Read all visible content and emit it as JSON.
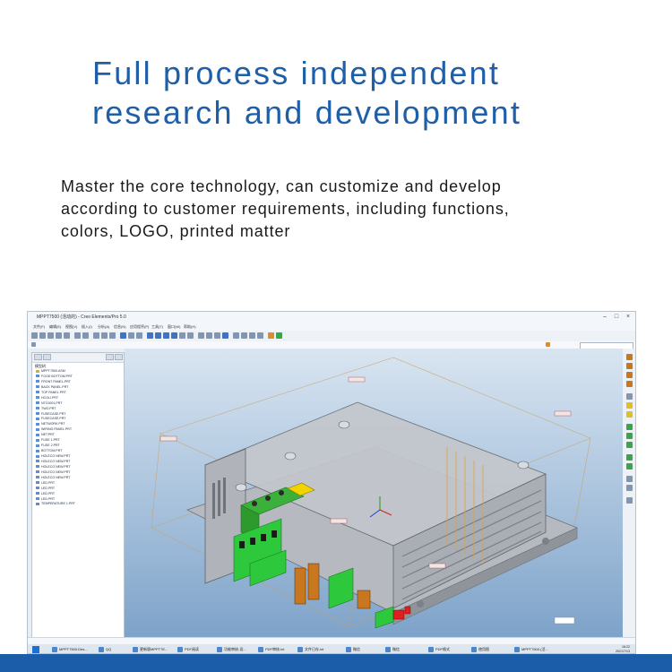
{
  "headline": {
    "line1": "Full process independent",
    "line2": "research and development"
  },
  "subtext": {
    "line1": "Master the core technology, can customize and develop",
    "line2": "according to customer requirements, including functions,",
    "line3": "colors, LOGO, printed matter"
  },
  "screenshot": {
    "window_title": "MPPT7500 (活动的) - Creo Elements/Pro 5.0",
    "menu": [
      "文件(F)",
      "编辑(E)",
      "视图(V)",
      "插入(I)",
      "分析(A)",
      "信息(N)",
      "应用程序(P)",
      "工具(T)",
      "窗口(W)",
      "帮助(H)"
    ],
    "tree_header": "模型树",
    "tree_items": [
      "MPPT7500.ASM",
      "FOOD BOTTOM.PRT",
      "FRONT PANEL.PRT",
      "BACK PANEL.PRT",
      "TOP PANEL.PRT",
      "HCOLI.PRT",
      "NTC0001.PRT",
      "TWO.PRT",
      "FUSECASE.PRT",
      "FUSECASE.PRT",
      "NETWORK.PRT",
      "WIRING PANEL.PRT",
      "NET.PRT",
      "FUSE 1.PRT",
      "FUSE 2.PRT",
      "BOTTOM.PRT",
      "HOLECO NEW.PRT",
      "HOLECO NEW.PRT",
      "HOLECO NEW.PRT",
      "HOLECO NEW.PRT",
      "HOLECO NEW.PRT",
      "LED.PRT",
      "LED.PRT",
      "LED.PRT",
      "LED.PRT",
      "TEMPERATURE 1.PRT"
    ],
    "taskbar_items": [
      "MPPT7500.Des...",
      "QQ",
      "更新版MPPT7E...",
      "PDF阅读",
      "功能审核-设...",
      "PDF审核.txt",
      "文件已存.txt",
      "微信",
      "微信",
      "PDF格式",
      "使用图",
      "MPPT7500.(活..."
    ],
    "clock_time": "16:22",
    "clock_date": "2021/7/13",
    "accent_colors": {
      "brand_blue": "#1f5fa8",
      "pcb_green": "#2ec83c",
      "header_terminal": "#3bb03b",
      "capacitor_orange": "#c8771e",
      "led_red": "#e02020",
      "enclosure_grey": "#b8bcc2"
    }
  }
}
